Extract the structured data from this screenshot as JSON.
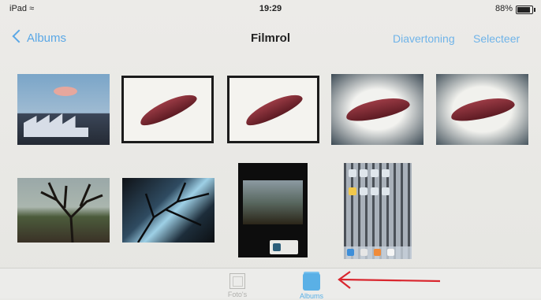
{
  "status": {
    "device": "iPad",
    "wifi_icon": "wifi-icon",
    "time": "19:29",
    "battery": "88%"
  },
  "nav": {
    "back_label": "Albums",
    "title": "Filmrol",
    "slideshow_label": "Diavertoning",
    "select_label": "Selecteer"
  },
  "photos": [
    {
      "name": "building-sky"
    },
    {
      "name": "leaf-1"
    },
    {
      "name": "leaf-2"
    },
    {
      "name": "leaf-3"
    },
    {
      "name": "leaf-4"
    },
    {
      "name": "tree-field"
    },
    {
      "name": "tree-blue"
    },
    {
      "name": "screenshot-dark"
    },
    {
      "name": "screenshot-ipad"
    }
  ],
  "tabbar": {
    "photos_label": "Foto's",
    "albums_label": "Albums"
  },
  "annotation": {
    "arrow_color": "#d9262e"
  },
  "colors": {
    "accent": "#5aa7e6",
    "background": "#ebebe8"
  }
}
